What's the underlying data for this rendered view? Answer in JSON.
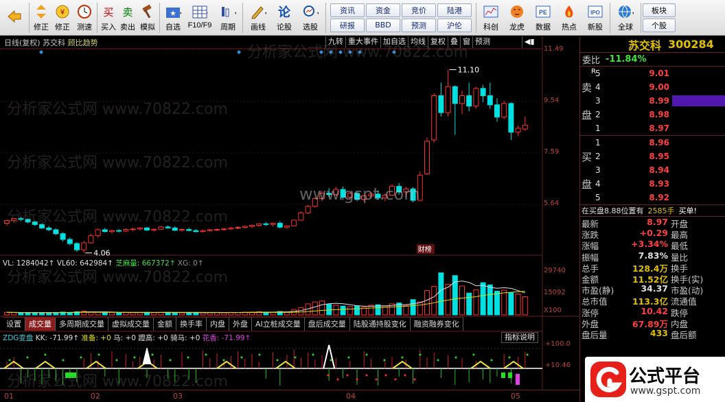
{
  "toolbar": {
    "buttons": [
      {
        "id": "back",
        "label": "",
        "icon": "back-arrow-icon"
      },
      {
        "id": "revise",
        "label": "修正",
        "icon": "updown-arrow-icon"
      },
      {
        "id": "wealth",
        "label": "修正",
        "icon": "yen-icon"
      },
      {
        "id": "test",
        "label": "测速",
        "icon": "clock-icon"
      },
      {
        "id": "buy",
        "label": "买入",
        "icon": "buy-icon"
      },
      {
        "id": "sell",
        "label": "卖出",
        "icon": "sell-icon"
      },
      {
        "id": "sim",
        "label": "模拟",
        "icon": "hammer-icon"
      },
      {
        "id": "watch",
        "label": "自选",
        "icon": "star-folder-icon"
      },
      {
        "id": "f10",
        "label": "F10/F9",
        "icon": "grid-icon"
      },
      {
        "id": "period",
        "label": "周期",
        "icon": "period-icon"
      },
      {
        "id": "draw",
        "label": "画线",
        "icon": "pencil-icon"
      },
      {
        "id": "stock",
        "label": "论股",
        "icon": "chat-icon"
      },
      {
        "id": "select",
        "label": "选股",
        "icon": "magnifier-icon"
      }
    ],
    "grid_buttons": [
      "资讯",
      "资金",
      "竞价",
      "陆港",
      "研报",
      "BBD",
      "预测",
      "沪伦"
    ],
    "buttons2": [
      {
        "id": "kechuang",
        "label": "科创",
        "icon": "chart-icon"
      },
      {
        "id": "tiger",
        "label": "龙虎",
        "icon": "tiger-icon"
      },
      {
        "id": "data",
        "label": "数据",
        "icon": "pe-icon"
      },
      {
        "id": "hot",
        "label": "热点",
        "icon": "fire-icon"
      },
      {
        "id": "ipo",
        "label": "新股",
        "icon": "ipo-icon"
      },
      {
        "id": "global",
        "label": "全球",
        "icon": "globe-icon"
      }
    ],
    "grid2": [
      "板块",
      "个股"
    ]
  },
  "chart": {
    "period": "日线(复权)",
    "stock": "苏交科",
    "indicator": "顾比趋势",
    "func_buttons": [
      "九转",
      "重大事件",
      "加自选",
      "均线",
      "复权",
      "叠",
      "窗",
      "预测"
    ],
    "price_axis": [
      "11.49",
      "9.54",
      "7.59",
      "5.64"
    ],
    "vol_axis": [
      "29740",
      "15092",
      "X100"
    ],
    "zdg_axis": [
      "+100.0",
      "+10.46"
    ],
    "high_label": "11.10",
    "low_label": "4.06",
    "event_label": "财榜",
    "vol_header": {
      "vl": "VL: 1284042↑",
      "vl60": "VL60: 642984↑",
      "zhima": "芝麻量: 667372↑",
      "xg": "XG: 0↑"
    },
    "tabs": [
      "设置",
      "成交量",
      "多周期成交量",
      "虚拟成交量",
      "金额",
      "换手率",
      "内盘",
      "外盘",
      "AI立桩成交量",
      "盘后成交量",
      "陆股通持股变化",
      "融资融券变化"
    ],
    "active_tab": "成交量",
    "zdg_header": {
      "name": "ZDG变盘",
      "kk": "KK: -71.99↑",
      "zb": "准备: +0",
      "ma": "马: +0",
      "dz": "蹬高: +0",
      "qm": "骑马: +0",
      "hx": "花香: -71.99↑"
    },
    "zdg_help": "指标说明",
    "dates": [
      "01",
      "02",
      "03",
      "04",
      "05"
    ],
    "watermark": "分析家公式网  www.70822.com",
    "watermark2": "www.gspt.com"
  },
  "quote": {
    "name": "苏交科",
    "code": "300284",
    "weibi_label": "委比",
    "weibi": "-11.84%",
    "r_label": "R",
    "sell_label": [
      "卖",
      "盘"
    ],
    "buy_label": [
      "买",
      "盘"
    ],
    "sell": [
      {
        "lvl": "5",
        "price": "9.01"
      },
      {
        "lvl": "4",
        "price": "9.00"
      },
      {
        "lvl": "3",
        "price": "8.99"
      },
      {
        "lvl": "2",
        "price": "8.98"
      },
      {
        "lvl": "1",
        "price": "8.97"
      }
    ],
    "buy": [
      {
        "lvl": "1",
        "price": "8.96"
      },
      {
        "lvl": "2",
        "price": "8.95"
      },
      {
        "lvl": "3",
        "price": "8.94"
      },
      {
        "lvl": "4",
        "price": "8.93"
      },
      {
        "lvl": "5",
        "price": "8.92"
      }
    ],
    "inbuy_text": "在买盘8.88位置有",
    "inbuy_qty": "2585手",
    "inbuy_action": "买单!",
    "stats": [
      {
        "k1": "最新",
        "v1": "8.97",
        "c": "up",
        "k2": "开盘"
      },
      {
        "k1": "涨跌",
        "v1": "+0.29",
        "c": "up",
        "k2": "最高"
      },
      {
        "k1": "涨幅",
        "v1": "+3.34%",
        "c": "up",
        "k2": "最低"
      },
      {
        "k1": "振幅",
        "v1": "7.83%",
        "c": "wt",
        "k2": "量比"
      },
      {
        "k1": "总手",
        "v1": "128.4万",
        "c": "yl",
        "k2": "换手"
      },
      {
        "k1": "金额",
        "v1": "11.52亿",
        "c": "yl",
        "k2": "换手(实)"
      },
      {
        "k1": "市盈(静)",
        "v1": "34.37",
        "c": "wt",
        "k2": "市盈(动)"
      },
      {
        "k1": "总市值",
        "v1": "113.3亿",
        "c": "yl",
        "k2": "流通值"
      },
      {
        "k1": "涨停",
        "v1": "10.42",
        "c": "up",
        "k2": "跌停"
      },
      {
        "k1": "外盘",
        "v1": "67.89万",
        "c": "up",
        "k2": "内盘"
      },
      {
        "k1": "盘后量",
        "v1": "433",
        "c": "yl",
        "k2": "盘后额"
      }
    ]
  },
  "logo": {
    "name": "公式平台",
    "url": "www.gspt.com"
  },
  "colors": {
    "up": "#ff3030",
    "down": "#00e0e0",
    "bg": "#000000",
    "grid": "#6a2020",
    "accent": "#e0c000"
  },
  "chart_data": {
    "type": "candlestick",
    "price_ylim": [
      4.0,
      11.8
    ],
    "candles": [
      [
        5.2,
        5.35,
        5.1,
        5.3
      ],
      [
        5.3,
        5.4,
        5.22,
        5.38
      ],
      [
        5.38,
        5.45,
        5.28,
        5.35
      ],
      [
        5.35,
        5.38,
        5.2,
        5.25
      ],
      [
        5.25,
        5.3,
        5.1,
        5.15
      ],
      [
        5.15,
        5.2,
        4.98,
        5.02
      ],
      [
        5.02,
        5.1,
        4.9,
        4.95
      ],
      [
        4.95,
        5.0,
        4.75,
        4.8
      ],
      [
        4.8,
        4.85,
        4.5,
        4.58
      ],
      [
        4.58,
        4.65,
        4.35,
        4.42
      ],
      [
        4.42,
        4.48,
        4.1,
        4.18
      ],
      [
        4.18,
        4.52,
        4.06,
        4.45
      ],
      [
        4.45,
        4.8,
        4.42,
        4.72
      ],
      [
        4.72,
        5.0,
        4.65,
        4.95
      ],
      [
        4.95,
        5.02,
        4.85,
        4.88
      ],
      [
        4.88,
        4.95,
        4.8,
        4.92
      ],
      [
        4.92,
        4.98,
        4.85,
        4.9
      ],
      [
        4.9,
        5.0,
        4.86,
        4.96
      ],
      [
        4.96,
        5.02,
        4.9,
        4.98
      ],
      [
        4.98,
        5.05,
        4.92,
        5.02
      ],
      [
        5.02,
        5.06,
        4.9,
        4.94
      ],
      [
        4.94,
        5.0,
        4.88,
        4.97
      ],
      [
        4.97,
        5.1,
        4.95,
        5.06
      ],
      [
        5.06,
        5.12,
        5.0,
        5.02
      ],
      [
        5.02,
        5.08,
        4.9,
        4.93
      ],
      [
        4.93,
        5.0,
        4.88,
        4.96
      ],
      [
        4.96,
        5.02,
        4.9,
        4.92
      ],
      [
        4.92,
        4.98,
        4.85,
        4.88
      ],
      [
        4.88,
        4.95,
        4.84,
        4.92
      ],
      [
        4.92,
        4.98,
        4.88,
        4.95
      ],
      [
        4.95,
        5.0,
        4.9,
        4.96
      ],
      [
        4.96,
        5.02,
        4.92,
        4.98
      ],
      [
        4.98,
        5.05,
        4.94,
        5.02
      ],
      [
        5.02,
        5.08,
        4.98,
        5.04
      ],
      [
        5.04,
        5.1,
        5.0,
        5.08
      ],
      [
        5.08,
        5.15,
        5.02,
        5.12
      ],
      [
        5.12,
        5.2,
        5.06,
        5.18
      ],
      [
        5.18,
        5.25,
        5.1,
        5.15
      ],
      [
        5.15,
        5.22,
        5.08,
        5.2
      ],
      [
        5.2,
        5.28,
        5.0,
        5.05
      ],
      [
        5.05,
        5.12,
        4.98,
        5.1
      ],
      [
        5.1,
        5.35,
        5.08,
        5.32
      ],
      [
        5.32,
        5.65,
        5.3,
        5.6
      ],
      [
        5.6,
        5.9,
        5.55,
        5.85
      ],
      [
        5.85,
        6.2,
        5.8,
        6.15
      ],
      [
        6.15,
        6.45,
        6.05,
        6.35
      ],
      [
        6.35,
        6.55,
        6.2,
        6.3
      ],
      [
        6.3,
        6.6,
        6.25,
        6.5
      ],
      [
        6.5,
        6.62,
        6.1,
        6.2
      ],
      [
        6.2,
        6.4,
        6.1,
        6.35
      ],
      [
        6.35,
        6.42,
        6.05,
        6.12
      ],
      [
        6.12,
        6.3,
        6.05,
        6.25
      ],
      [
        6.25,
        6.4,
        6.15,
        6.32
      ],
      [
        6.32,
        6.45,
        6.1,
        6.18
      ],
      [
        6.18,
        6.35,
        6.05,
        6.28
      ],
      [
        6.28,
        6.7,
        6.25,
        6.62
      ],
      [
        6.62,
        6.75,
        6.3,
        6.4
      ],
      [
        6.4,
        6.6,
        6.2,
        6.52
      ],
      [
        6.52,
        6.58,
        6.0,
        6.08
      ],
      [
        6.08,
        7.2,
        6.05,
        7.05
      ],
      [
        7.1,
        8.5,
        7.05,
        8.35
      ],
      [
        8.4,
        10.2,
        8.3,
        10.1
      ],
      [
        10.1,
        10.6,
        9.3,
        9.45
      ],
      [
        9.45,
        11.1,
        9.3,
        10.45
      ],
      [
        10.45,
        10.5,
        8.6,
        9.8
      ],
      [
        9.8,
        10.3,
        9.4,
        10.1
      ],
      [
        10.1,
        10.6,
        9.5,
        9.7
      ],
      [
        9.7,
        10.45,
        9.6,
        10.38
      ],
      [
        10.38,
        10.52,
        9.85,
        10.1
      ],
      [
        10.1,
        10.6,
        9.6,
        9.75
      ],
      [
        9.75,
        10.0,
        9.1,
        9.28
      ],
      [
        9.28,
        9.9,
        9.2,
        9.8
      ],
      [
        9.8,
        9.85,
        8.4,
        8.7
      ],
      [
        8.7,
        8.95,
        8.55,
        8.85
      ],
      [
        8.82,
        9.3,
        8.75,
        8.97
      ]
    ],
    "volume_ylim": [
      0,
      33000
    ],
    "volumes": [
      1800,
      1700,
      1600,
      1500,
      1700,
      1600,
      1500,
      1700,
      2000,
      1800,
      2200,
      2600,
      2100,
      1900,
      1800,
      1700,
      1600,
      1700,
      1600,
      1700,
      1800,
      1600,
      1700,
      1800,
      1600,
      1500,
      1700,
      1600,
      1500,
      1600,
      1700,
      1600,
      1800,
      1700,
      1900,
      2000,
      2200,
      1900,
      1800,
      2400,
      2100,
      3800,
      5200,
      7800,
      9200,
      9800,
      7400,
      6800,
      6200,
      5800,
      6400,
      5400,
      6800,
      7200,
      6200,
      7800,
      8400,
      6600,
      10800,
      9200,
      17200,
      20200,
      29740,
      21600,
      27800,
      20400,
      15400,
      17800,
      22800,
      21200,
      16800,
      17400,
      15600,
      14800,
      12840
    ],
    "zdg_kk": [
      0,
      0,
      0,
      0,
      0,
      0,
      0,
      0,
      0,
      0,
      0,
      0,
      0,
      0,
      0,
      0,
      0,
      0,
      0,
      0,
      0,
      0,
      0,
      0,
      0,
      0,
      0,
      0,
      0,
      0,
      0,
      0,
      0,
      0,
      0,
      0,
      0,
      0,
      0,
      0,
      0,
      0,
      0,
      0,
      0,
      0,
      0,
      0,
      0,
      0,
      0,
      0,
      0,
      0,
      0,
      0,
      0,
      0,
      0,
      0,
      0,
      0,
      0,
      0,
      0,
      0,
      0,
      0,
      0,
      0,
      0,
      0,
      0,
      0,
      -71.99
    ]
  }
}
